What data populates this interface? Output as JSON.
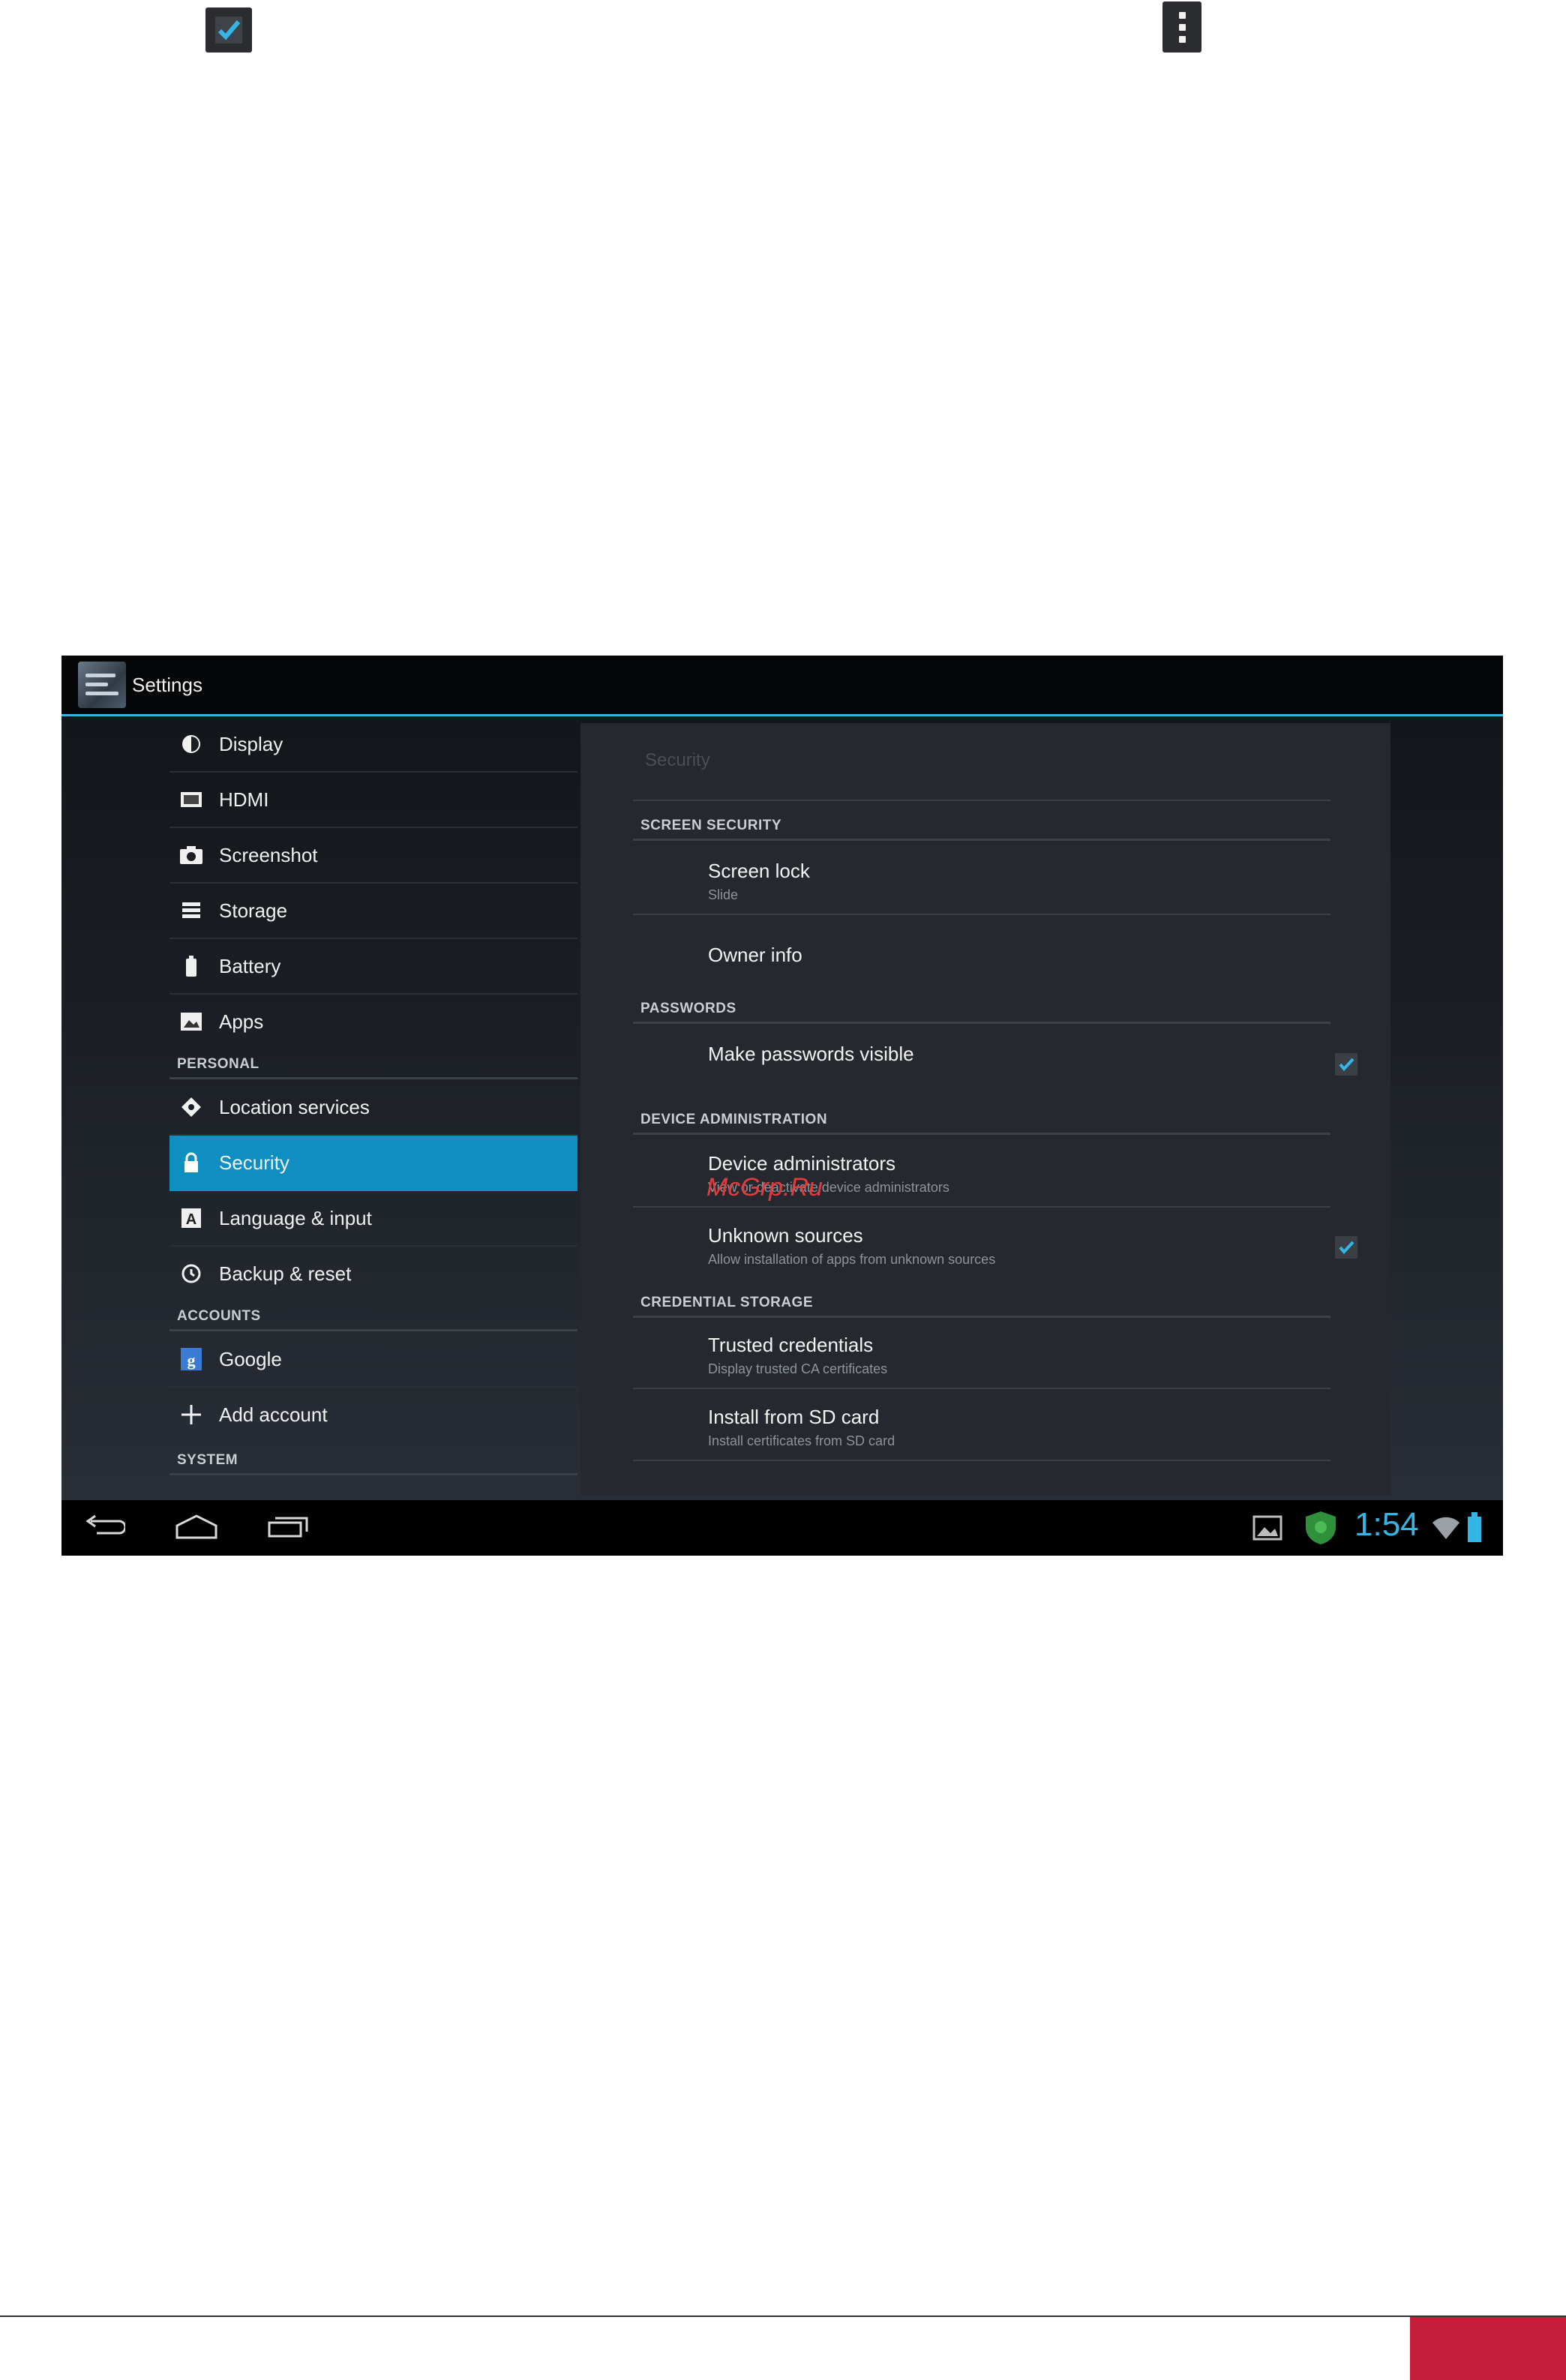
{
  "app": {
    "title": "Settings"
  },
  "nav": {
    "items": [
      {
        "label": "Display",
        "icon": "brightness-icon"
      },
      {
        "label": "HDMI",
        "icon": "hdmi-icon"
      },
      {
        "label": "Screenshot",
        "icon": "camera-icon"
      },
      {
        "label": "Storage",
        "icon": "storage-icon"
      },
      {
        "label": "Battery",
        "icon": "battery-icon"
      },
      {
        "label": "Apps",
        "icon": "apps-icon"
      },
      {
        "label": "Location services",
        "icon": "location-icon"
      },
      {
        "label": "Security",
        "icon": "lock-icon",
        "active": true
      },
      {
        "label": "Language & input",
        "icon": "language-icon"
      },
      {
        "label": "Backup & reset",
        "icon": "backup-icon"
      },
      {
        "label": "Google",
        "icon": "google-icon"
      },
      {
        "label": "Add account",
        "icon": "plus-icon"
      }
    ],
    "headers": {
      "personal": "PERSONAL",
      "accounts": "ACCOUNTS",
      "system": "SYSTEM"
    }
  },
  "panel": {
    "title": "Security",
    "sections": {
      "screen_security": "SCREEN SECURITY",
      "passwords": "PASSWORDS",
      "device_administration": "DEVICE ADMINISTRATION",
      "credential_storage": "CREDENTIAL STORAGE"
    },
    "prefs": {
      "screen_lock": {
        "title": "Screen lock",
        "summary": "Slide"
      },
      "owner_info": {
        "title": "Owner info"
      },
      "make_passwords_visible": {
        "title": "Make passwords visible",
        "checked": true
      },
      "device_administrators": {
        "title": "Device administrators",
        "summary": "View or deactivate device administrators"
      },
      "unknown_sources": {
        "title": "Unknown sources",
        "summary": "Allow installation of apps from unknown sources",
        "checked": true
      },
      "trusted_credentials": {
        "title": "Trusted credentials",
        "summary": "Display trusted CA certificates"
      },
      "install_from_sd": {
        "title": "Install from SD card",
        "summary": "Install certificates from SD card"
      }
    }
  },
  "watermark": "McGrp.Ru",
  "status": {
    "time": "1:54"
  },
  "colors": {
    "accent": "#33b5e5",
    "active_item": "#0f8ec2",
    "footer_red": "#c41e3a"
  }
}
